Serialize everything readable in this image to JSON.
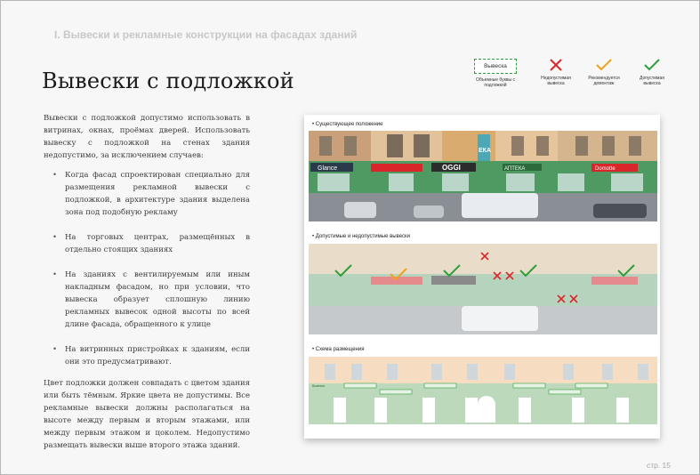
{
  "header": {
    "section_title": "I. Вывески и рекламные конструкции на фасадах зданий"
  },
  "title": "Вывески с подложкой",
  "legend": [
    {
      "sign_text": "Вывеска",
      "caption": "Объемные буквы с подложкой",
      "icon": "dashed-sign-icon"
    },
    {
      "caption": "Недопустимая вывеска",
      "icon": "red-cross-icon",
      "color": "#e0262a"
    },
    {
      "caption": "Рекомендуется демонтаж",
      "icon": "orange-check-icon",
      "color": "#f2a21a"
    },
    {
      "caption": "Допустимая вывеска",
      "icon": "green-check-icon",
      "color": "#2e9e3a"
    }
  ],
  "body": {
    "intro": "Вывески с подложкой допустимо использовать в витринах, окнах, проёмах дверей. Использовать вывеску с подложкой на стенах здания недопустимо, за исключением случаев:",
    "bullets": [
      "Когда фасад спроектирован специально для размещения рекламной вывески с подложкой, в архитектуре здания выделена зона под подобную рекламу",
      "На торговых центрах, размещённых в отдельно стоящих зданиях",
      "На зданиях с вентилируемым или иным накладным фасадом, но при условии, что вывеска образует сплошную линию рекламных вывесок одной высоты по всей длине фасада, обращенного к улице",
      "На витринных пристройках к зданиям, если они это предусматривают."
    ],
    "closing": "Цвет подложки должен совпадать с цветом здания или быть тёмным. Яркие цвета не допустимы. Все рекламные вывески должны располагаться на высоте между первым и вторым этажами, или между первым этажом и цоколем. Недопустимо размещать вывески выше второго этажа зданий."
  },
  "figure": {
    "sections": [
      {
        "label": "Существующее положение"
      },
      {
        "label": "Допустимые и недопустимые вывески"
      },
      {
        "label": "Схема размещения"
      }
    ],
    "storefront_signs": [
      "Glance",
      "OGGI",
      "АПТЕКА",
      "Domotte",
      "ЕКА"
    ],
    "scheme_sign_label": "Вывеска"
  },
  "footer": {
    "page": "стр. 15"
  },
  "colors": {
    "accent_green": "#2e9e3a",
    "cross_red": "#e0262a",
    "check_orange": "#f2a21a"
  }
}
